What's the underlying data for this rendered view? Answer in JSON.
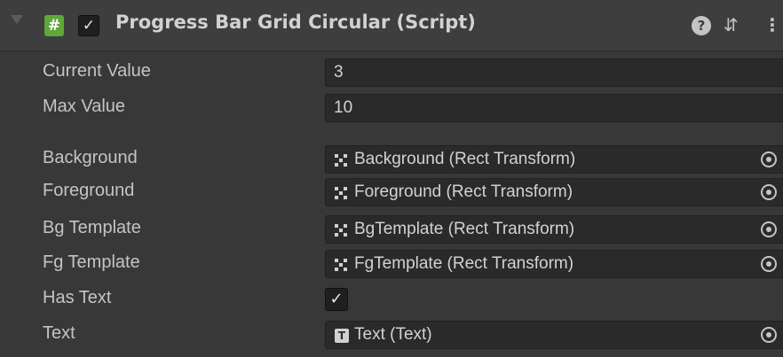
{
  "component": {
    "title": "Progress Bar Grid Circular (Script)",
    "enabled_mark": "✓",
    "script_icon_glyph": "#",
    "icons": [
      "foldout-arrow-icon",
      "script-icon",
      "help-icon",
      "presets-icon",
      "context-menu-icon"
    ]
  },
  "fields": {
    "current_value": {
      "label": "Current Value",
      "value": "3"
    },
    "max_value": {
      "label": "Max Value",
      "value": "10"
    },
    "background": {
      "label": "Background",
      "value": "Background (Rect Transform)"
    },
    "foreground": {
      "label": "Foreground",
      "value": "Foreground (Rect Transform)"
    },
    "bg_template": {
      "label": "Bg Template",
      "value": "BgTemplate (Rect Transform)"
    },
    "fg_template": {
      "label": "Fg Template",
      "value": "FgTemplate (Rect Transform)"
    },
    "has_text": {
      "label": "Has Text",
      "checked": true,
      "mark": "✓"
    },
    "text": {
      "label": "Text",
      "value": "Text (Text)"
    }
  },
  "colors": {
    "panel_bg": "#383838",
    "header_bg": "#3e3e3e",
    "field_bg": "#2a2a2a",
    "script_icon": "#5fa83a",
    "text": "#c4c4c4"
  }
}
